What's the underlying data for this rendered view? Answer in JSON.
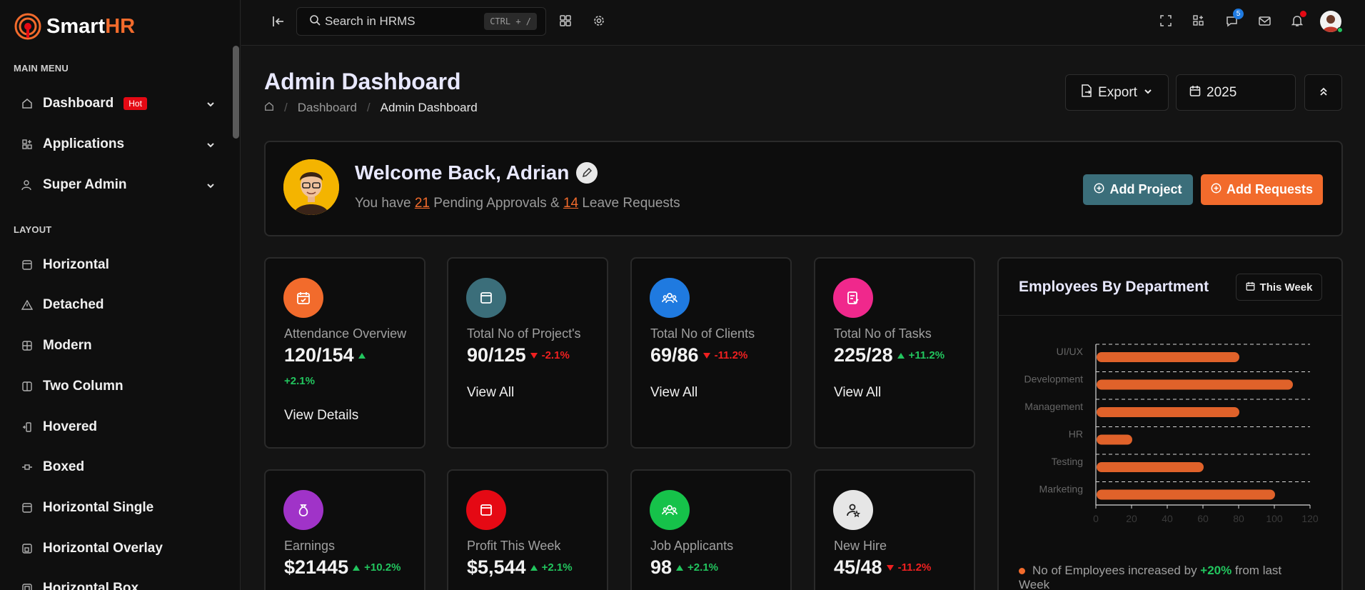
{
  "brand": {
    "name_a": "Smart",
    "name_b": "HR"
  },
  "sidebar": {
    "main_menu_label": "MAIN MENU",
    "main_items": [
      {
        "label": "Dashboard",
        "icon": "home-icon",
        "badge": "Hot"
      },
      {
        "label": "Applications",
        "icon": "apps-icon"
      },
      {
        "label": "Super Admin",
        "icon": "user-shield-icon"
      }
    ],
    "layout_label": "LAYOUT",
    "layout_items": [
      {
        "label": "Horizontal",
        "icon": "layout-icon"
      },
      {
        "label": "Detached",
        "icon": "triangle-icon"
      },
      {
        "label": "Modern",
        "icon": "grid-icon"
      },
      {
        "label": "Two Column",
        "icon": "columns-icon"
      },
      {
        "label": "Hovered",
        "icon": "hover-icon"
      },
      {
        "label": "Boxed",
        "icon": "boxed-icon"
      },
      {
        "label": "Horizontal Single",
        "icon": "layout-single-icon"
      },
      {
        "label": "Horizontal Overlay",
        "icon": "layout-overlay-icon"
      },
      {
        "label": "Horizontal Box",
        "icon": "layout-box-icon"
      }
    ]
  },
  "topbar": {
    "search_placeholder": "Search in HRMS",
    "search_shortcut": "CTRL + /",
    "chat_count": "5"
  },
  "header": {
    "title": "Admin Dashboard",
    "breadcrumb": [
      "Dashboard",
      "Admin Dashboard"
    ],
    "export_label": "Export",
    "year": "2025"
  },
  "welcome": {
    "title": "Welcome Back, Adrian",
    "sub_a": "You have ",
    "pending": "21",
    "sub_b": " Pending Approvals & ",
    "leave": "14",
    "sub_c": " Leave Requests",
    "add_project": "Add Project",
    "add_requests": "Add Requests"
  },
  "stats": [
    {
      "label": "Attendance Overview",
      "value": "120/154",
      "trend": "+2.1%",
      "dir": "up",
      "link": "View Details",
      "color": "#f26b2c",
      "icon": "calendar-check-icon"
    },
    {
      "label": "Total No of Project's",
      "value": "90/125",
      "trend": "-2.1%",
      "dir": "down",
      "link": "View All",
      "color": "#3b6e7a",
      "icon": "browser-icon"
    },
    {
      "label": "Total No of Clients",
      "value": "69/86",
      "trend": "-11.2%",
      "dir": "down",
      "link": "View All",
      "color": "#1f7ae0",
      "icon": "users-icon"
    },
    {
      "label": "Total No of Tasks",
      "value": "225/28",
      "trend": "+11.2%",
      "dir": "up",
      "link": "View All",
      "color": "#f0288c",
      "icon": "checklist-icon"
    },
    {
      "label": "Earnings",
      "value": "$21445",
      "trend": "+10.2%",
      "dir": "up",
      "color": "#a033c8",
      "icon": "money-bag-icon"
    },
    {
      "label": "Profit This Week",
      "value": "$5,544",
      "trend": "+2.1%",
      "dir": "up",
      "color": "#e50914",
      "icon": "browser-icon"
    },
    {
      "label": "Job Applicants",
      "value": "98",
      "trend": "+2.1%",
      "dir": "up",
      "color": "#16c24a",
      "icon": "users-icon"
    },
    {
      "label": "New Hire",
      "value": "45/48",
      "trend": "-11.2%",
      "dir": "down",
      "color": "#e6e6e6",
      "icon": "user-star-icon"
    }
  ],
  "dept_card": {
    "title": "Employees By Department",
    "range_label": "This Week",
    "footer_a": "No of Employees increased by ",
    "footer_pct": "+20%",
    "footer_b": " from last Week"
  },
  "chart_data": {
    "type": "bar",
    "orientation": "horizontal",
    "categories": [
      "UI/UX",
      "Development",
      "Management",
      "HR",
      "Testing",
      "Marketing"
    ],
    "values": [
      80,
      110,
      80,
      20,
      60,
      100
    ],
    "xlim": [
      0,
      120
    ],
    "xticks": [
      "0",
      "20",
      "40",
      "60",
      "80",
      "100",
      "120"
    ],
    "color": "#e0622a"
  }
}
